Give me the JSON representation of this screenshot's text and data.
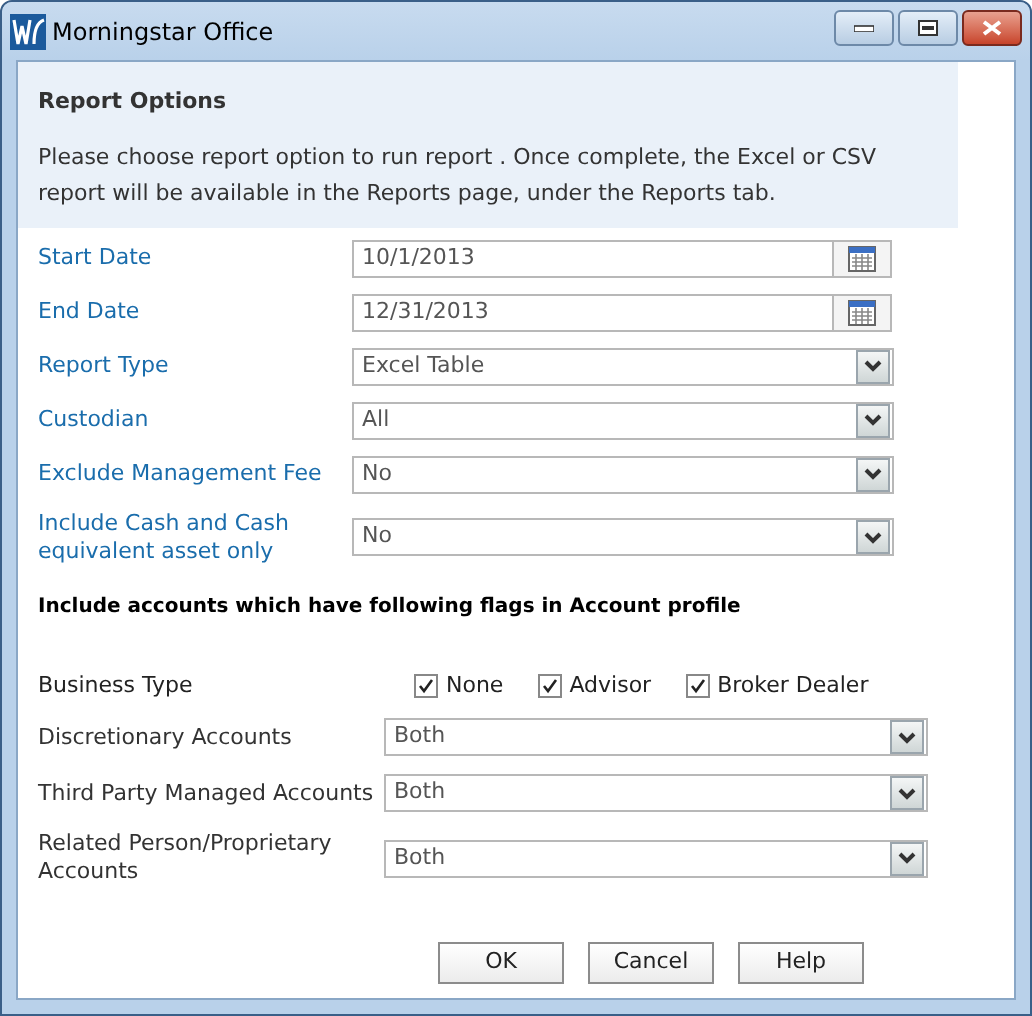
{
  "window": {
    "title": "Morningstar Office"
  },
  "header": {
    "title": "Report Options",
    "message": "Please choose report option to run report . Once complete, the Excel or CSV report will be available in the Reports page, under the Reports tab."
  },
  "fields": [
    {
      "label": "Start Date",
      "kind": "date",
      "value": "10/1/2013"
    },
    {
      "label": "End Date",
      "kind": "date",
      "value": "12/31/2013"
    },
    {
      "label": "Report Type",
      "kind": "select",
      "value": "Excel Table"
    },
    {
      "label": "Custodian",
      "kind": "select",
      "value": "All"
    },
    {
      "label": "Exclude Management Fee",
      "kind": "select",
      "value": "No"
    },
    {
      "label": "Include Cash and Cash equivalent asset only",
      "kind": "select",
      "value": "No"
    }
  ],
  "flags_heading": "Include accounts which have following flags in Account profile",
  "business_type": {
    "label": "Business Type",
    "options": [
      {
        "label": "None",
        "checked": true
      },
      {
        "label": "Advisor",
        "checked": true
      },
      {
        "label": "Broker Dealer",
        "checked": true
      }
    ]
  },
  "flag_fields": [
    {
      "label": "Discretionary Accounts",
      "value": "Both"
    },
    {
      "label": "Third Party Managed Accounts",
      "value": "Both"
    },
    {
      "label": "Related Person/Proprietary Accounts",
      "value": "Both"
    }
  ],
  "buttons": [
    "OK",
    "Cancel",
    "Help"
  ]
}
